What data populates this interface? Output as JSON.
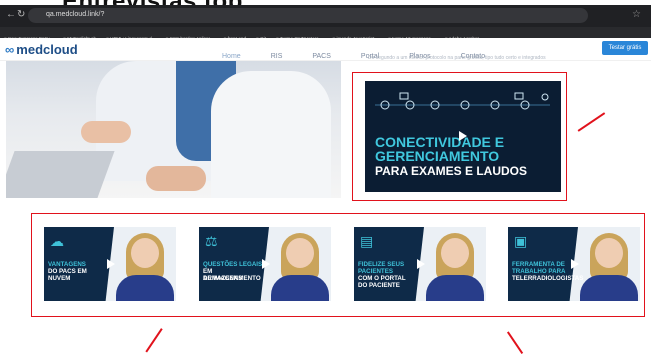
{
  "top_title": "Entrevistas top",
  "browser": {
    "url": "qa.medcloud.link/?",
    "bookmarks": [
      "New Expresso Entry...",
      "MyEnglishLab",
      "HTML: Linguagem d...",
      "CSS border: Aplicar...",
      "front-end",
      "Git",
      "Turma OnZ3 Interc...",
      "imendo JavaScript...",
      "turma-13-mensage...",
      "Adobe Acrobat"
    ]
  },
  "site": {
    "logo": "medcloud",
    "nav": [
      "Home",
      "RIS",
      "PACS",
      "Portal",
      "Planos",
      "Contato"
    ],
    "cta": "Testar grátis",
    "faint_text": "Do segundo a um melhor protocolo na parte gráfica, tipo tudo certo e integrados"
  },
  "main_banner": {
    "line1": "CONECTIVIDADE E",
    "line2": "GERENCIAMENTO",
    "line3": "PARA EXAMES E LAUDOS"
  },
  "thumbnails": [
    {
      "icon": "cloud-icon",
      "lines_cyan": [
        "VANTAGENS"
      ],
      "lines_white": [
        "DO PACS EM",
        "NUVEM"
      ]
    },
    {
      "icon": "gavel-icon",
      "lines_cyan": [
        "QUESTÕES LEGAIS"
      ],
      "lines_white": [
        "EM ARMAZENAMENTO",
        "DE IMAGENS"
      ]
    },
    {
      "icon": "document-icon",
      "lines_cyan": [
        "FIDELIZE SEUS",
        "PACIENTES"
      ],
      "lines_white": [
        "COM O PORTAL",
        "DO PACIENTE"
      ]
    },
    {
      "icon": "monitor-icon",
      "lines_cyan": [
        "FERRAMENTA DE",
        "TRABALHO PARA"
      ],
      "lines_white": [
        "TELERRADIOLOGISTAS"
      ]
    }
  ],
  "colors": {
    "annotation_red": "#e1121c",
    "cyan": "#3fc1d8",
    "navy": "#0e2a48",
    "cta_blue": "#2a86d8"
  }
}
